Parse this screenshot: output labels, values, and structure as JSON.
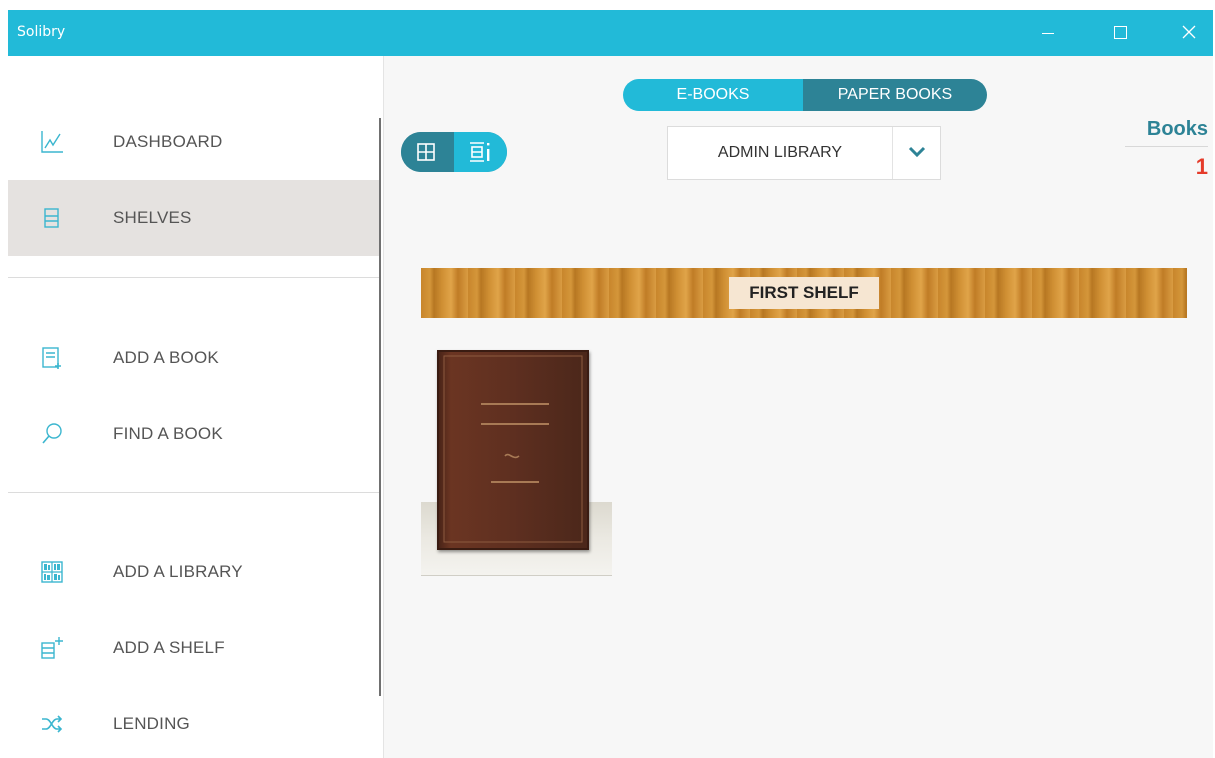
{
  "window": {
    "title": "Solibry"
  },
  "sidebar": {
    "items": [
      {
        "label": "DASHBOARD",
        "icon": "chart-line-icon",
        "active": false
      },
      {
        "label": "SHELVES",
        "icon": "shelves-icon",
        "active": true
      },
      {
        "label": "ADD A BOOK",
        "icon": "add-book-icon",
        "active": false
      },
      {
        "label": "FIND A BOOK",
        "icon": "search-icon",
        "active": false
      },
      {
        "label": "ADD A LIBRARY",
        "icon": "library-icon",
        "active": false
      },
      {
        "label": "ADD A SHELF",
        "icon": "add-shelf-icon",
        "active": false
      },
      {
        "label": "LENDING",
        "icon": "shuffle-icon",
        "active": false
      }
    ]
  },
  "main": {
    "tabs": [
      {
        "label": "E-BOOKS",
        "selected": false
      },
      {
        "label": "PAPER BOOKS",
        "selected": true
      }
    ],
    "view_modes": [
      {
        "icon": "grid-view-icon",
        "selected": true
      },
      {
        "icon": "shelf-view-icon",
        "selected": false
      }
    ],
    "library_select": {
      "value": "ADMIN LIBRARY"
    },
    "stats": {
      "label": "Books",
      "count": "1"
    },
    "shelves": [
      {
        "name": "FIRST SHELF",
        "books": [
          {
            "icon": "book-cover-icon"
          }
        ]
      }
    ]
  },
  "colors": {
    "accent": "#22bad8",
    "accent_dark": "#2d8396",
    "count_red": "#e53b2a",
    "icon": "#3bb6cf"
  }
}
